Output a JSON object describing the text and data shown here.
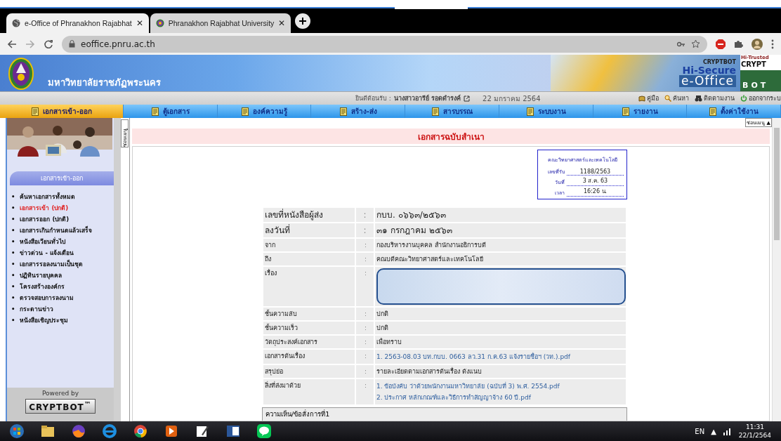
{
  "browser": {
    "tabs": [
      {
        "title": "e-Office of Phranakhon Rajabhat",
        "close": "✕",
        "selected": true
      },
      {
        "title": "Phranakhon Rajabhat University",
        "close": "✕",
        "selected": false
      }
    ],
    "url": "eoffice.pnru.ac.th"
  },
  "banner": {
    "university": "มหาวิทยาลัยราชภัฏพระนคร",
    "brand_small": "CRYPTBOT",
    "brand_secure": "Hi-Secure",
    "brand_office": "e-Office",
    "trusted": "Hi-Trusted",
    "trusted_name": "CRYPT",
    "trusted_bot": "BOT"
  },
  "welcome": {
    "label": "ยินดีต้อนรับ :",
    "user": "นางสาวอารีย์ รอดดำรงค์",
    "date": "22 มกราคม 2564",
    "links": [
      "คู่มือ",
      "ค้นหา",
      "ติดตามงาน",
      "ออกจากระบ"
    ]
  },
  "menu": [
    {
      "label": "เอกสารเข้า-ออก",
      "selected": true
    },
    {
      "label": "ตู้เอกสาร",
      "selected": false
    },
    {
      "label": "องค์ความรู้",
      "selected": false
    },
    {
      "label": "สร้าง-ส่ง",
      "selected": false
    },
    {
      "label": "สารบรรณ",
      "selected": false
    },
    {
      "label": "ระบบงาน",
      "selected": false
    },
    {
      "label": "รายงาน",
      "selected": false
    },
    {
      "label": "ตั้งค่าใช้งาน",
      "selected": false
    }
  ],
  "hide_menu_top": "ซ่อนเมนู ▲",
  "hide_menu_side": "ซ่อนเมนู",
  "sidebar": {
    "title": "เอกสารเข้า-ออก",
    "items": [
      {
        "bullet": "•",
        "label": "ค้นหาเอกสารทั้งหมด",
        "selected": false
      },
      {
        "bullet": "•",
        "label": "เอกสารเข้า (ปกติ)",
        "selected": true
      },
      {
        "bullet": "•",
        "label": "เอกสารออก (ปกติ)",
        "selected": false
      },
      {
        "bullet": "•",
        "label": "เอกสารเกินกำหนดแล้วเสร็จ",
        "selected": false
      },
      {
        "bullet": "•",
        "label": "หนังสือเวียนทั่วไป",
        "selected": false
      },
      {
        "bullet": "•",
        "label": "ข่าวด่วน - แจ้งเตือน",
        "selected": false
      },
      {
        "bullet": "•",
        "label": "เอกสารรอลงนามเป็นชุด",
        "selected": false
      },
      {
        "bullet": "•",
        "label": "ปฏิทินรายบุคคล",
        "selected": false
      },
      {
        "bullet": "•",
        "label": "โครงสร้างองค์กร",
        "selected": false
      },
      {
        "bullet": "•",
        "label": "ตรวจสอบการลงนาม",
        "selected": false
      },
      {
        "bullet": "•",
        "label": "กระดานข่าว",
        "selected": false
      },
      {
        "bullet": "•",
        "label": "หนังสือเชิญประชุม",
        "selected": false
      }
    ],
    "powered_by": "Powered by",
    "powered_logo": "CRYPTBOT$^{™}$"
  },
  "document": {
    "title": "เอกสารฉบับสำเนา",
    "stamp": {
      "faculty": "คณะวิทยาศาสตร์และเทคโนโลยี",
      "rows": [
        {
          "label": "เลขที่รับ",
          "value": "1188/2563"
        },
        {
          "label": "วันที่",
          "value": "3 ส.ค. 63"
        },
        {
          "label": "เวลา",
          "value": "16:26 น."
        }
      ]
    },
    "fields": [
      {
        "label": "เลขที่หนังสือผู้ส่ง",
        "separator": ":",
        "kind": "large",
        "values": [
          "กบบ. ๐๖๖๓/๒๕๖๓"
        ]
      },
      {
        "label": "ลงวันที่",
        "separator": ":",
        "kind": "large",
        "values": [
          "๓๑ กรกฎาคม ๒๕๖๓"
        ]
      },
      {
        "label": "จาก",
        "separator": ":",
        "kind": "text",
        "values": [
          "กองบริหารงานบุคคล สำนักงานอธิการบดี"
        ]
      },
      {
        "label": "ถึง",
        "separator": ":",
        "kind": "text",
        "values": [
          "คณบดีคณะวิทยาศาสตร์และเทคโนโลยี"
        ]
      },
      {
        "label": "เรื่อง",
        "separator": ":",
        "kind": "redacted"
      },
      {
        "label": "ชั้นความลับ",
        "separator": ":",
        "kind": "text",
        "values": [
          "ปกติ"
        ]
      },
      {
        "label": "ชั้นความเร็ว",
        "separator": ":",
        "kind": "text",
        "values": [
          "ปกติ"
        ]
      },
      {
        "label": "วัตถุประสงค์เอกสาร",
        "separator": ":",
        "kind": "text",
        "values": [
          "เพื่อทราบ"
        ]
      },
      {
        "label": "เอกสารต้นเรื่อง",
        "separator": ":",
        "kind": "links",
        "values": [
          "1. 2563-08.03 บท.กบบ. 0663 ลว.31 ก.ค.63 แจ้งรายชื่อฯ (วท.).pdf"
        ]
      },
      {
        "label": "สรุปย่อ",
        "separator": ":",
        "kind": "text",
        "values": [
          "รายละเอียดตามเอกสารต้นเรื่อง ดังแนบ"
        ]
      },
      {
        "label": "สิ่งที่ส่งมาด้วย",
        "separator": ":",
        "kind": "links",
        "values": [
          "1. ข้อบังคับ ว่าด้วยพนักงานมหาวิทยาลัย (ฉบับที่ 3) พ.ศ. 2554.pdf",
          "2. ประกาศ หลักเกณฑ์และวิธีการทำสัญญาจ้าง 60 ปี.pdf"
        ]
      }
    ],
    "opinion_header": "ความเห็น/ข้อสั่งการที่1"
  },
  "taskbar": {
    "language": "EN",
    "tray_arrow": "▲",
    "time": "11:31",
    "date": "22/1/2564"
  }
}
